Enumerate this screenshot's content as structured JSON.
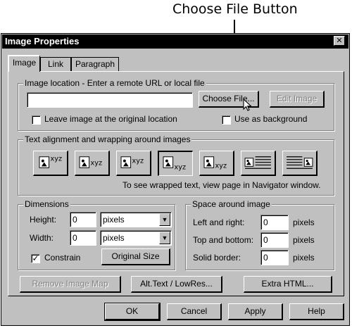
{
  "callout": {
    "label": "Choose File Button"
  },
  "dialog": {
    "title": "Image Properties",
    "close_glyph": "✕",
    "tabs": [
      {
        "label": "Image",
        "active": true
      },
      {
        "label": "Link",
        "active": false
      },
      {
        "label": "Paragraph",
        "active": false
      }
    ],
    "image_location": {
      "legend": "Image location - Enter a remote URL or local file",
      "url_value": "",
      "choose_file": "Choose File...",
      "edit_image": "Edit Image",
      "leave_original": "Leave image at the original location",
      "use_background": "Use as background"
    },
    "alignment": {
      "legend": "Text alignment and wrapping around images",
      "options": [
        "xyz",
        "xyz",
        "xyz",
        "xyz",
        "xyz",
        "wrap-left",
        "wrap-right"
      ],
      "note": "To see wrapped text, view page in Navigator window."
    },
    "dimensions": {
      "legend": "Dimensions",
      "height_label": "Height:",
      "height_value": "0",
      "height_unit": "pixels",
      "width_label": "Width:",
      "width_value": "0",
      "width_unit": "pixels",
      "constrain": "Constrain",
      "constrain_checked": true,
      "original_size": "Original Size"
    },
    "space": {
      "legend": "Space around image",
      "left_right_label": "Left and right:",
      "left_right_value": "0",
      "top_bottom_label": "Top and bottom:",
      "top_bottom_value": "0",
      "border_label": "Solid border:",
      "border_value": "0",
      "unit": "pixels"
    },
    "panel_buttons": {
      "remove_map": "Remove Image Map",
      "alt_text": "Alt.Text / LowRes...",
      "extra_html": "Extra HTML..."
    },
    "footer": {
      "ok": "OK",
      "cancel": "Cancel",
      "apply": "Apply",
      "help": "Help"
    }
  }
}
